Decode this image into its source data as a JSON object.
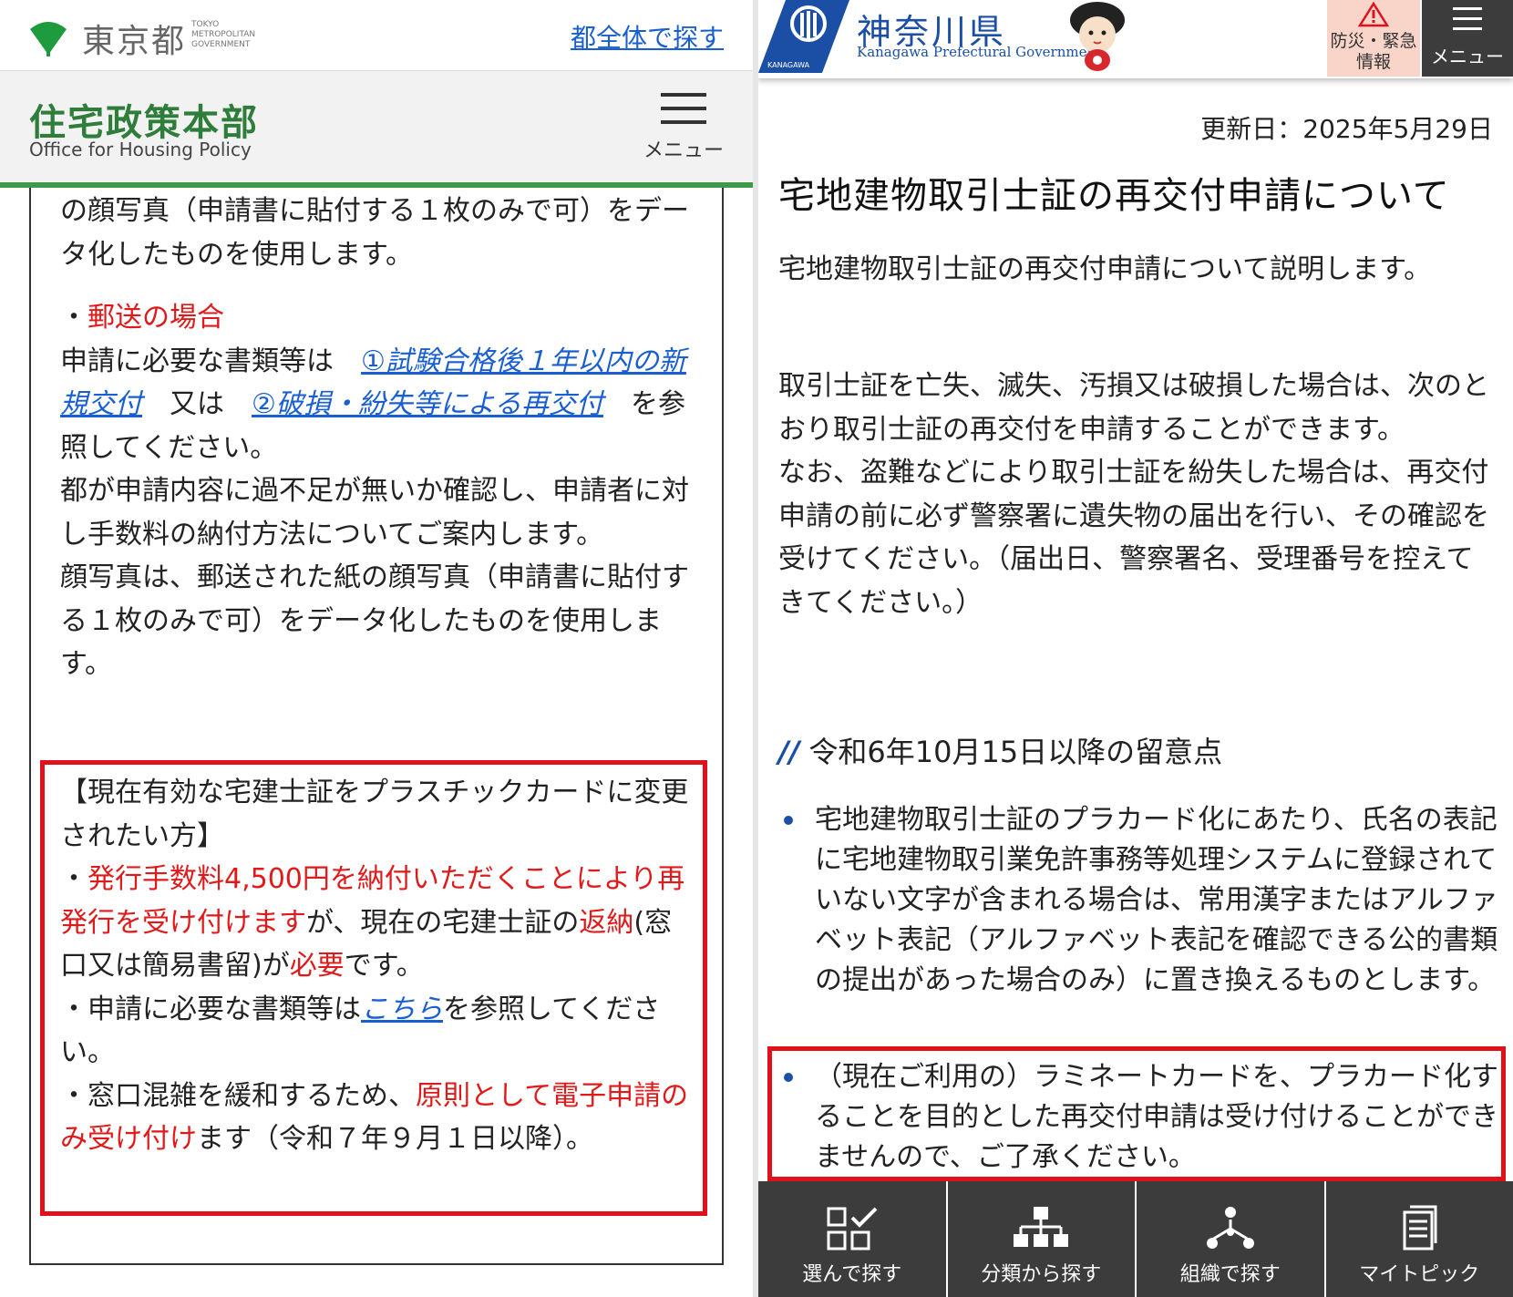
{
  "tokyo": {
    "logo_text": "東京都",
    "logo_en": "TOKYO METROPOLITAN GOVERNMENT",
    "search_link": "都全体で探す",
    "dept_title": "住宅政策本部",
    "dept_en": "Office for Housing Policy",
    "menu_label": "メニュー",
    "body": {
      "p1": "の顔写真（申請書に貼付する１枚のみで可）をデータ化したものを使用します。",
      "mail_bullet": "・",
      "mail_heading": "郵送の場合",
      "p2_a": "申請に必要な書類等は　",
      "link1": "①試験合格後１年以内の新規交付",
      "p2_b": "　又は　",
      "link2": "②破損・紛失等による再交付",
      "p2_c": "　を参照してください。",
      "p3": "都が申請内容に過不足が無いか確認し、申請者に対し手数料の納付方法についてご案内します。",
      "p4": "顔写真は、郵送された紙の顔写真（申請書に貼付する１枚のみで可）をデータ化したものを使用します。"
    },
    "box": {
      "heading": "【現在有効な宅建士証をプラスチックカードに変更されたい方】",
      "b1_pre": "・",
      "b1_red": "発行手数料4,500円を納付いただくことにより再発行を受け付けます",
      "b1_mid": "が、現在の宅建士証の",
      "b1_red2": "返納",
      "b1_mid2": "(窓口又は簡易書留)が",
      "b1_red3": "必要",
      "b1_end": "です。",
      "b2_pre": "・申請に必要な書類等は",
      "b2_link": "こちら",
      "b2_end": "を参照してください。",
      "b3_pre": "・窓口混雑を緩和するため、",
      "b3_red": "原則として電子申請のみ受け付け",
      "b3_end": "ます（令和７年９月１日以降）。"
    },
    "colors": {
      "green": "#3e9a4a",
      "red": "#e01a1a",
      "link": "#1a5fd1"
    }
  },
  "kanagawa": {
    "logo_name": "神奈川県",
    "logo_en": "Kanagawa Prefectural Government",
    "logo_small": "KANAGAWA",
    "bosai_label": "防災・緊急情報",
    "menu_label": "メニュー",
    "updated": "更新日：2025年5月29日",
    "title": "宅地建物取引士証の再交付申請について",
    "lead": "宅地建物取引士証の再交付申請について説明します。",
    "para1": "取引士証を亡失、滅失、汚損又は破損した場合は、次のとおり取引士証の再交付を申請することができます。",
    "para2": "なお、盗難などにより取引士証を紛失した場合は、再交付申請の前に必ず警察署に遺失物の届出を行い、その確認を受けてください。（届出日、警察署名、受理番号を控えてきてください。）",
    "h2_slashes": "//",
    "h2": "令和6年10月15日以降の留意点",
    "li1": "宅地建物取引士証のプラカード化にあたり、氏名の表記に宅地建物取引業免許事務等処理システムに登録されていない文字が含まれる場合は、常用漢字またはアルファベット表記（アルファベット表記を確認できる公的書類の提出があった場合のみ）に置き換えるものとします。",
    "li2": "（現在ご利用の）ラミネートカードを、プラカード化することを目的とした再交付申請は受け付けることができませんので、ご了承ください。",
    "nav": [
      {
        "label": "選んで探す",
        "icon": "select-icon"
      },
      {
        "label": "分類から探す",
        "icon": "category-tree-icon"
      },
      {
        "label": "組織で探す",
        "icon": "organization-icon"
      },
      {
        "label": "マイトピック",
        "icon": "my-topic-icon"
      }
    ],
    "colors": {
      "blue": "#1b4fa6",
      "red": "#e0101c",
      "nav_bg": "#3c3c3c",
      "bosai_bg": "#f9d4c8"
    }
  }
}
